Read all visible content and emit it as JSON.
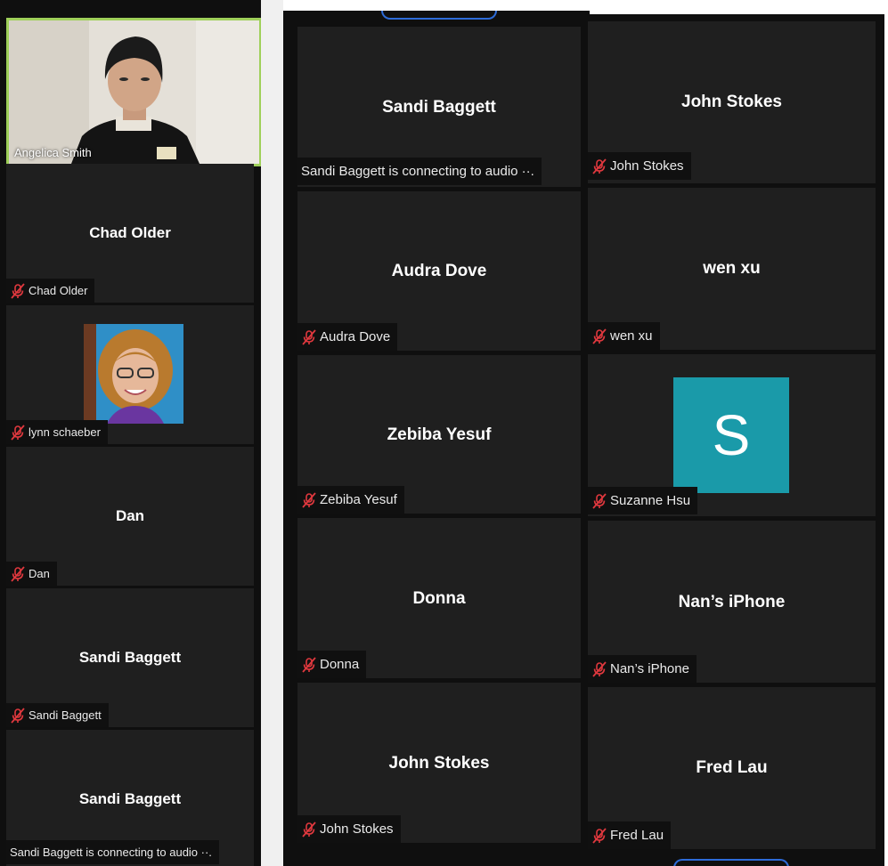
{
  "left_strip": {
    "active_speaker": {
      "name": "Angelica Smith"
    },
    "tiles": [
      {
        "center_name": "Chad Older",
        "label": "Chad Older"
      },
      {
        "label": "lynn schaeber"
      },
      {
        "center_name": "Dan",
        "label": "Dan"
      },
      {
        "center_name": "Sandi Baggett",
        "label": "Sandi Baggett"
      },
      {
        "center_name": "Sandi Baggett",
        "label": "Sandi Baggett is connecting to audio ··."
      }
    ]
  },
  "grid": {
    "col1": [
      {
        "center_name": "Sandi Baggett",
        "label": "Sandi Baggett is connecting to audio ··."
      },
      {
        "center_name": "Audra Dove",
        "label": "Audra Dove"
      },
      {
        "center_name": "Zebiba Yesuf",
        "label": "Zebiba Yesuf"
      },
      {
        "center_name": "Donna",
        "label": "Donna"
      },
      {
        "center_name": "John Stokes",
        "label": "John Stokes"
      }
    ],
    "col2": [
      {
        "center_name": "John Stokes",
        "label": "John Stokes"
      },
      {
        "center_name": "wen xu",
        "label": "wen xu"
      },
      {
        "avatar_letter": "S",
        "label": "Suzanne Hsu"
      },
      {
        "center_name": "Nan’s iPhone",
        "label": "Nan’s iPhone"
      },
      {
        "center_name": "Fred Lau",
        "label": "Fred Lau"
      }
    ]
  },
  "colors": {
    "active_speaker_border": "#9fd05a",
    "avatar_bg": "#1a9aa9",
    "mute_icon": "#e0383e",
    "tile_bg": "#1f1f1f"
  },
  "icons": {
    "muted": "mic-muted-icon"
  }
}
